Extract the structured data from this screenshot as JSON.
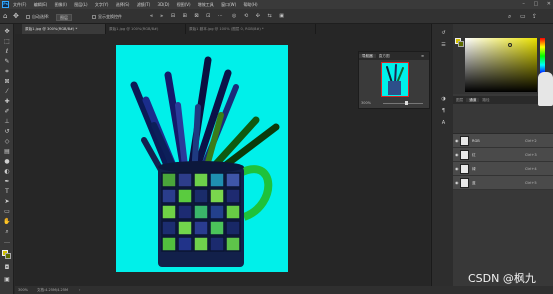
{
  "menubar": {
    "logo": "Ps",
    "items": [
      "文件(F)",
      "编辑(E)",
      "图像(I)",
      "图层(L)",
      "文字(Y)",
      "选择(S)",
      "滤镜(T)",
      "3D(D)",
      "视图(V)",
      "增效工具",
      "窗口(W)",
      "帮助(H)"
    ],
    "window_controls": [
      "–",
      "□",
      "✕"
    ]
  },
  "options": {
    "auto_select_label": "自动选择:",
    "auto_select_value": "图层",
    "show_transform_label": "显示变换控件"
  },
  "tabs": [
    {
      "label": "原始1.jpg @ 300%(RGB/8#) *",
      "active": true
    },
    {
      "label": "原始1.jpg @ 100%(RGB/8#)",
      "active": false
    },
    {
      "label": "原始1 副本.jpg @ 100% (图层 0, RGB/8#) *",
      "active": false
    }
  ],
  "toolbar_icons": [
    "move-icon",
    "marquee-icon",
    "lasso-icon",
    "quick-select-icon",
    "crop-icon",
    "frame-icon",
    "eyedropper-icon",
    "healing-icon",
    "brush-icon",
    "stamp-icon",
    "history-brush-icon",
    "eraser-icon",
    "gradient-icon",
    "blur-icon",
    "dodge-icon",
    "pen-icon",
    "type-icon",
    "path-select-icon",
    "rectangle-icon",
    "hand-icon",
    "zoom-icon",
    "more-icon",
    "colors-icon",
    "quickmask-icon",
    "screenmode-icon"
  ],
  "navigator": {
    "tabs": [
      {
        "label": "导航器",
        "active": true
      },
      {
        "label": "直方图",
        "active": false
      }
    ],
    "zoom": "300%"
  },
  "layers_panel": {
    "tabs": [
      {
        "label": "图层",
        "active": false
      },
      {
        "label": "通道",
        "active": true
      },
      {
        "label": "路径",
        "active": false
      }
    ],
    "rows": [
      {
        "name": "RGB",
        "shortcut": "Ctrl+2"
      },
      {
        "name": "红",
        "shortcut": "Ctrl+3"
      },
      {
        "name": "绿",
        "shortcut": "Ctrl+4"
      },
      {
        "name": "蓝",
        "shortcut": "Ctrl+5"
      }
    ]
  },
  "status": {
    "zoom": "300%",
    "doc_info": "文档:4.25M/4.25M"
  },
  "colors": {
    "foreground": "#d2c000",
    "background": "#5b6a00",
    "canvas_fill": "#00f0ea"
  },
  "watermark": "CSDN @枫九"
}
